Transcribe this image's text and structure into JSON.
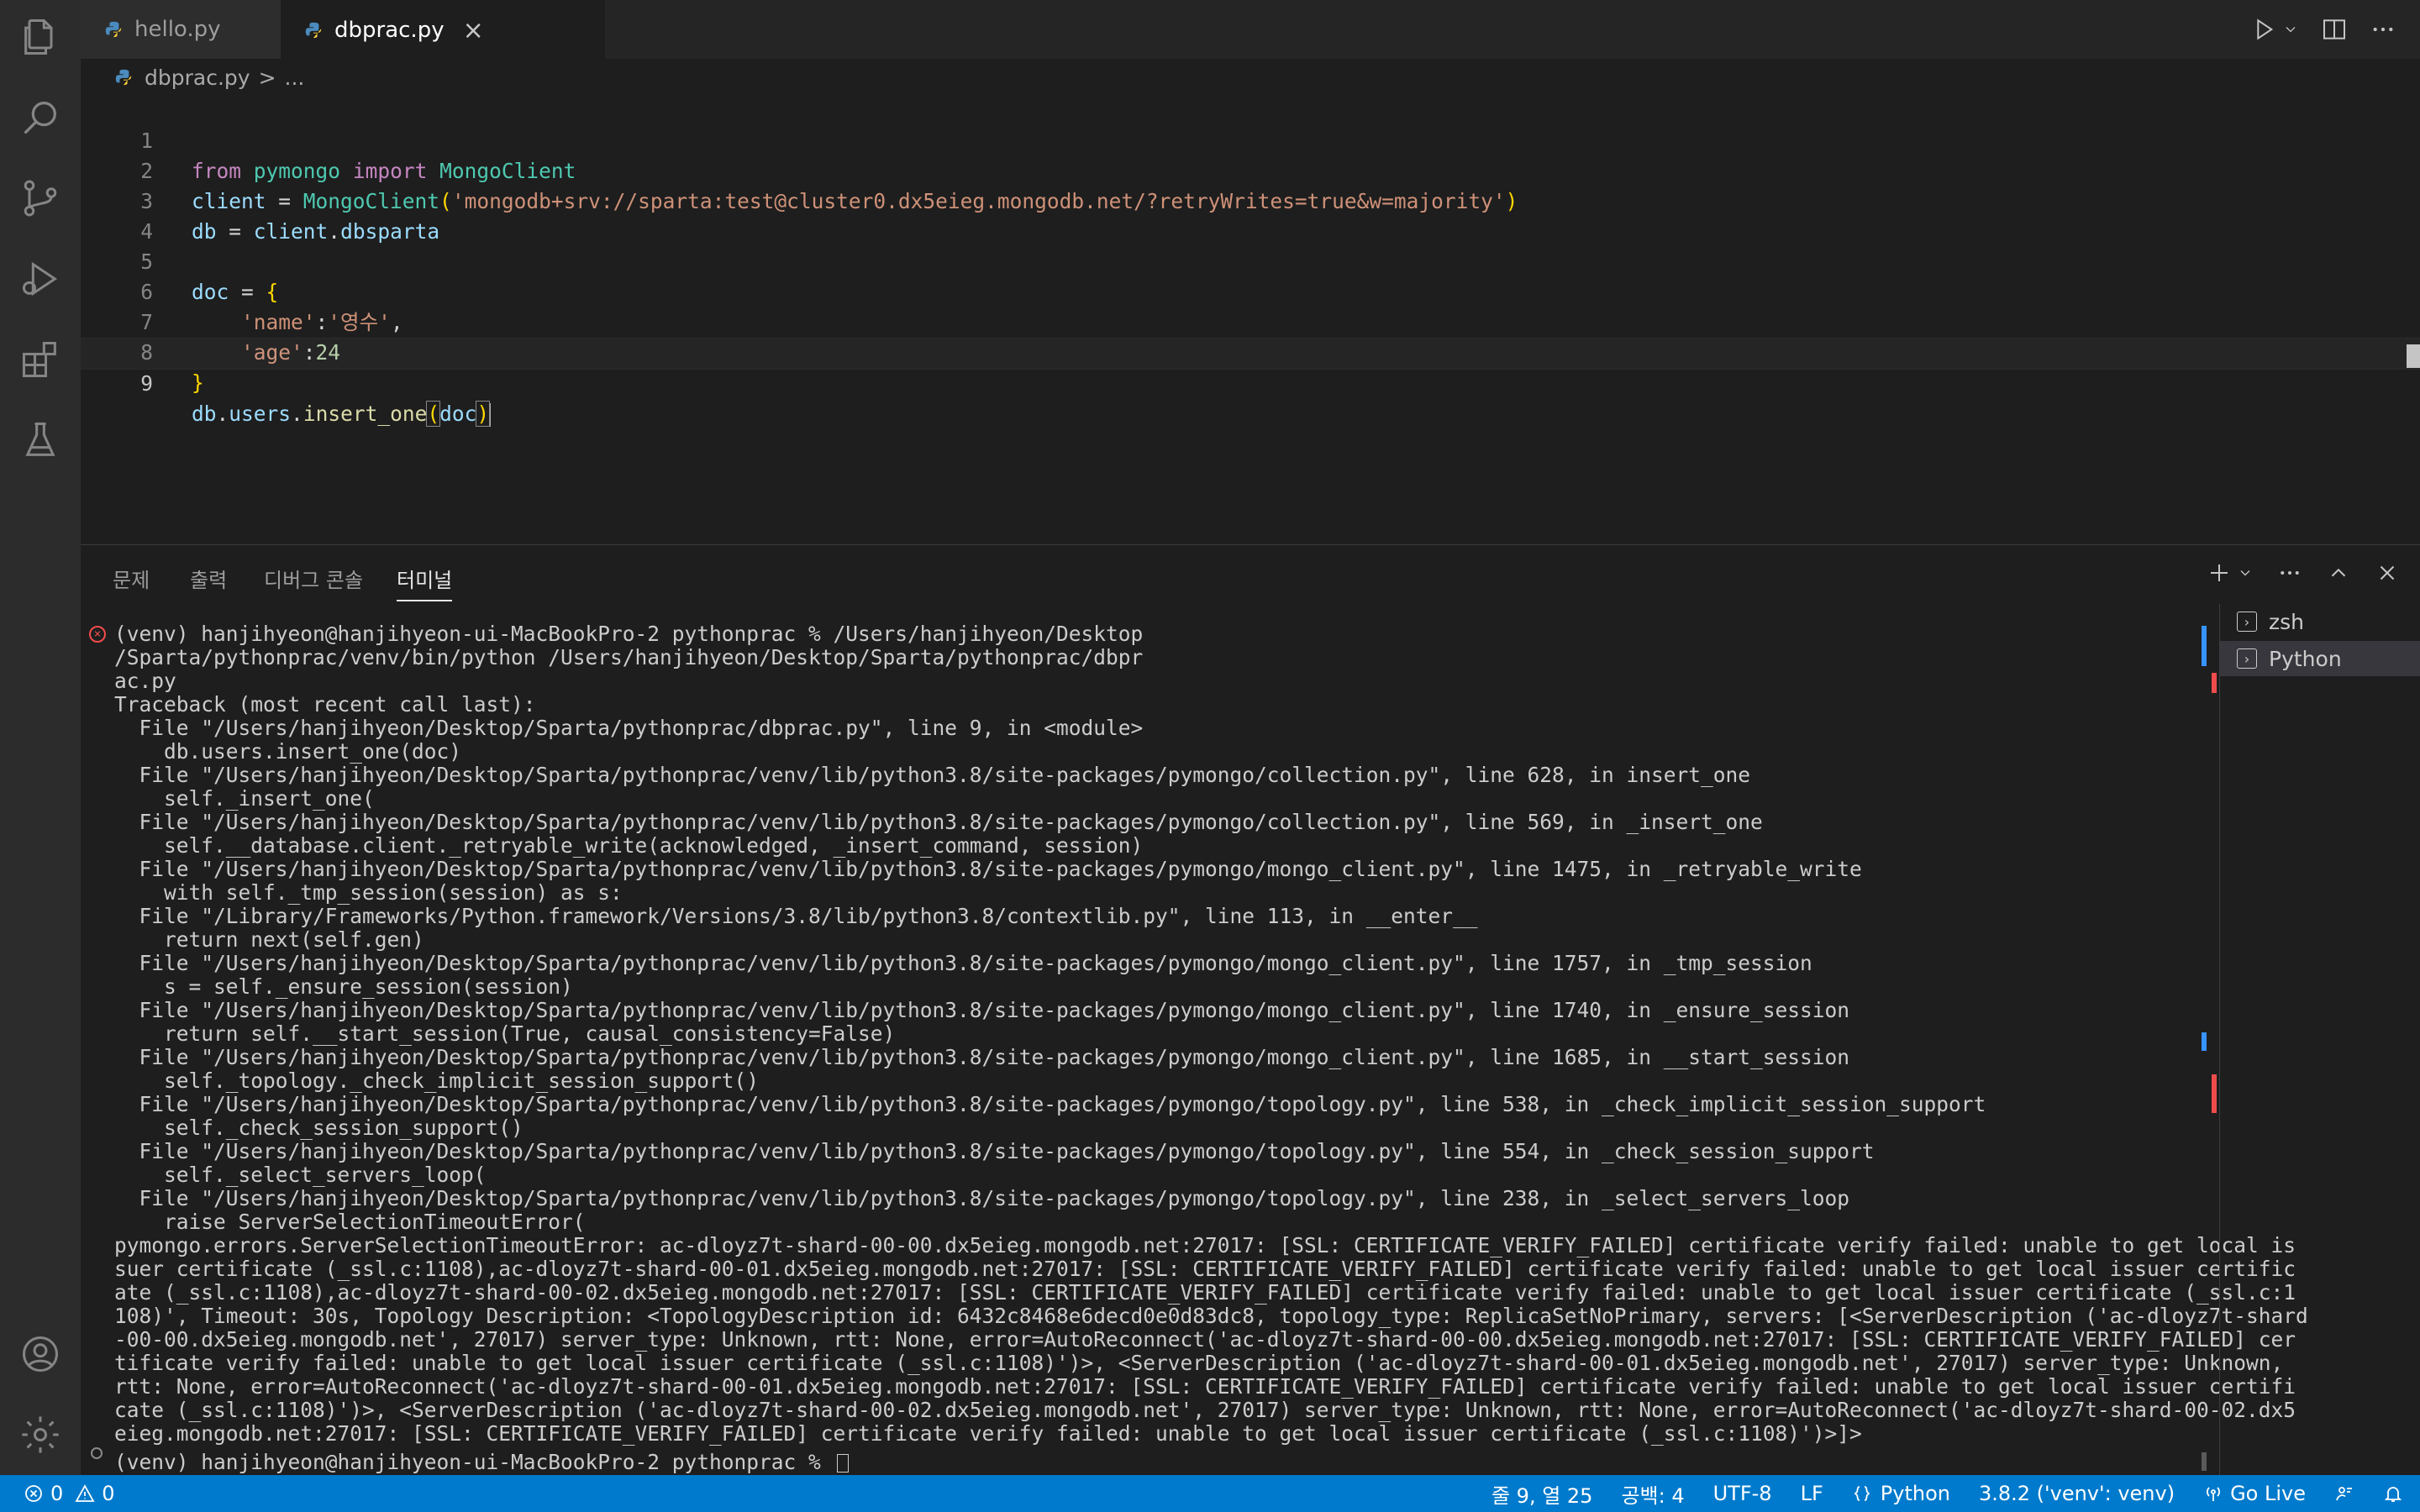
{
  "tabs": [
    {
      "label": "hello.py",
      "active": false
    },
    {
      "label": "dbprac.py",
      "active": true
    }
  ],
  "breadcrumb": {
    "file": "dbprac.py",
    "sep": ">",
    "more": "..."
  },
  "editor": {
    "lines": [
      {
        "num": "1"
      },
      {
        "num": "2"
      },
      {
        "num": "3"
      },
      {
        "num": "4"
      },
      {
        "num": "5"
      },
      {
        "num": "6"
      },
      {
        "num": "7"
      },
      {
        "num": "8"
      },
      {
        "num": "9"
      }
    ],
    "tokens": {
      "from": "from",
      "pymongo": "pymongo",
      "import": "import",
      "MongoClient": "MongoClient",
      "client": "client",
      "eq": " = ",
      "uri": "'mongodb+srv://sparta:test@cluster0.dx5eieg.mongodb.net/?retryWrites=true&w=majority'",
      "db": "db",
      "dbsparta": "dbsparta",
      "dot": ".",
      "doc": "doc",
      "lbrace": "{",
      "rbrace": "}",
      "name_key": "'name'",
      "name_val": "'영수'",
      "age_key": "'age'",
      "age_val": "24",
      "users": "users",
      "insert_one": "insert_one",
      "lparen": "(",
      "rparen": ")",
      "colon": ":",
      "comma": ","
    }
  },
  "panel": {
    "tabs": [
      "문제",
      "출력",
      "디버그 콘솔",
      "터미널"
    ],
    "active_tab": "터미널"
  },
  "terminal": {
    "lines": [
      "(venv) hanjihyeon@hanjihyeon-ui-MacBookPro-2 pythonprac % /Users/hanjihyeon/Desktop",
      "/Sparta/pythonprac/venv/bin/python /Users/hanjihyeon/Desktop/Sparta/pythonprac/dbpr",
      "ac.py",
      "Traceback (most recent call last):",
      "  File \"/Users/hanjihyeon/Desktop/Sparta/pythonprac/dbprac.py\", line 9, in <module>",
      "    db.users.insert_one(doc)",
      "  File \"/Users/hanjihyeon/Desktop/Sparta/pythonprac/venv/lib/python3.8/site-packages/pymongo/collection.py\", line 628, in insert_one",
      "    self._insert_one(",
      "  File \"/Users/hanjihyeon/Desktop/Sparta/pythonprac/venv/lib/python3.8/site-packages/pymongo/collection.py\", line 569, in _insert_one",
      "    self.__database.client._retryable_write(acknowledged, _insert_command, session)",
      "  File \"/Users/hanjihyeon/Desktop/Sparta/pythonprac/venv/lib/python3.8/site-packages/pymongo/mongo_client.py\", line 1475, in _retryable_write",
      "    with self._tmp_session(session) as s:",
      "  File \"/Library/Frameworks/Python.framework/Versions/3.8/lib/python3.8/contextlib.py\", line 113, in __enter__",
      "    return next(self.gen)",
      "  File \"/Users/hanjihyeon/Desktop/Sparta/pythonprac/venv/lib/python3.8/site-packages/pymongo/mongo_client.py\", line 1757, in _tmp_session",
      "    s = self._ensure_session(session)",
      "  File \"/Users/hanjihyeon/Desktop/Sparta/pythonprac/venv/lib/python3.8/site-packages/pymongo/mongo_client.py\", line 1740, in _ensure_session",
      "    return self.__start_session(True, causal_consistency=False)",
      "  File \"/Users/hanjihyeon/Desktop/Sparta/pythonprac/venv/lib/python3.8/site-packages/pymongo/mongo_client.py\", line 1685, in __start_session",
      "    self._topology._check_implicit_session_support()",
      "  File \"/Users/hanjihyeon/Desktop/Sparta/pythonprac/venv/lib/python3.8/site-packages/pymongo/topology.py\", line 538, in _check_implicit_session_support",
      "    self._check_session_support()",
      "  File \"/Users/hanjihyeon/Desktop/Sparta/pythonprac/venv/lib/python3.8/site-packages/pymongo/topology.py\", line 554, in _check_session_support",
      "    self._select_servers_loop(",
      "  File \"/Users/hanjihyeon/Desktop/Sparta/pythonprac/venv/lib/python3.8/site-packages/pymongo/topology.py\", line 238, in _select_servers_loop",
      "    raise ServerSelectionTimeoutError(",
      "pymongo.errors.ServerSelectionTimeoutError: ac-dloyz7t-shard-00-00.dx5eieg.mongodb.net:27017: [SSL: CERTIFICATE_VERIFY_FAILED] certificate verify failed: unable to get local is",
      "suer certificate (_ssl.c:1108),ac-dloyz7t-shard-00-01.dx5eieg.mongodb.net:27017: [SSL: CERTIFICATE_VERIFY_FAILED] certificate verify failed: unable to get local issuer certific",
      "ate (_ssl.c:1108),ac-dloyz7t-shard-00-02.dx5eieg.mongodb.net:27017: [SSL: CERTIFICATE_VERIFY_FAILED] certificate verify failed: unable to get local issuer certificate (_ssl.c:1",
      "108)', Timeout: 30s, Topology Description: <TopologyDescription id: 6432c8468e6decd0e0d83dc8, topology_type: ReplicaSetNoPrimary, servers: [<ServerDescription ('ac-dloyz7t-shard",
      "-00-00.dx5eieg.mongodb.net', 27017) server_type: Unknown, rtt: None, error=AutoReconnect('ac-dloyz7t-shard-00-00.dx5eieg.mongodb.net:27017: [SSL: CERTIFICATE_VERIFY_FAILED] cer",
      "tificate verify failed: unable to get local issuer certificate (_ssl.c:1108)')>, <ServerDescription ('ac-dloyz7t-shard-00-01.dx5eieg.mongodb.net', 27017) server_type: Unknown,",
      "rtt: None, error=AutoReconnect('ac-dloyz7t-shard-00-01.dx5eieg.mongodb.net:27017: [SSL: CERTIFICATE_VERIFY_FAILED] certificate verify failed: unable to get local issuer certifi",
      "cate (_ssl.c:1108)')>, <ServerDescription ('ac-dloyz7t-shard-00-02.dx5eieg.mongodb.net', 27017) server_type: Unknown, rtt: None, error=AutoReconnect('ac-dloyz7t-shard-00-02.dx5",
      "eieg.mongodb.net:27017: [SSL: CERTIFICATE_VERIFY_FAILED] certificate verify failed: unable to get local issuer certificate (_ssl.c:1108)')>]>",
      "(venv) hanjihyeon@hanjihyeon-ui-MacBookPro-2 pythonprac % "
    ],
    "sessions": [
      {
        "label": "zsh",
        "selected": false
      },
      {
        "label": "Python",
        "selected": true
      }
    ]
  },
  "status": {
    "errors": "0",
    "warnings": "0",
    "position": "줄 9, 열 25",
    "spaces": "공백: 4",
    "encoding": "UTF-8",
    "eol": "LF",
    "language": "Python",
    "interpreter": "3.8.2 ('venv': venv)",
    "golive": "Go Live"
  },
  "colors": {
    "statusbar": "#007acc",
    "activitybar": "#2c2c2c",
    "editor_bg": "#1e1e1e",
    "error": "#f14c4c"
  }
}
